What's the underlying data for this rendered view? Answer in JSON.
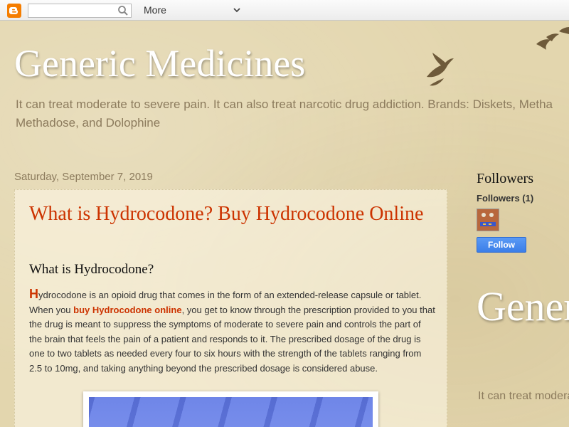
{
  "navbar": {
    "search_value": "",
    "more_label": "More",
    "brand_color": "#f57d00",
    "icons": [
      "blogger-logo-icon",
      "search-icon",
      "chevron-down-icon"
    ]
  },
  "header": {
    "title": "Generic Medicines",
    "description_line1": "It can treat moderate to severe pain. It can also treat narcotic drug addiction. Brands: Diskets, Metha",
    "description_line2": "Methadose, and Dolophine"
  },
  "post": {
    "date": "Saturday, September 7, 2019",
    "title": "What is Hydrocodone? Buy Hydrocodone Online",
    "subheading": "What is Hydrocodone?",
    "drop_cap": "H",
    "body_part1": "ydrocodone is an opioid drug that comes in the form of an extended-release capsule or tablet. When you ",
    "link_text": "buy Hydrocodone online",
    "body_part2": ", you get to know through the prescription provided to you that the drug is meant to suppress the symptoms of moderate to severe pain and controls the part of the brain that feels the pain of a patient and responds to it. The prescribed dosage of the drug is one to two tablets as needed every four to six hours with the strength of the tablets ranging from 2.5 to 10mg, and taking anything beyond the prescribed dosage is considered abuse.",
    "accent_color": "#cc3300"
  },
  "sidebar": {
    "followers_widget_title": "Followers",
    "followers_count_label": "Followers (1)",
    "follow_button_label": "Follow",
    "follow_button_color": "#3b7ee8",
    "repeat_title": "Generic Medicines",
    "repeat_description": "It can treat moderate to severe pain. It can also treat"
  }
}
